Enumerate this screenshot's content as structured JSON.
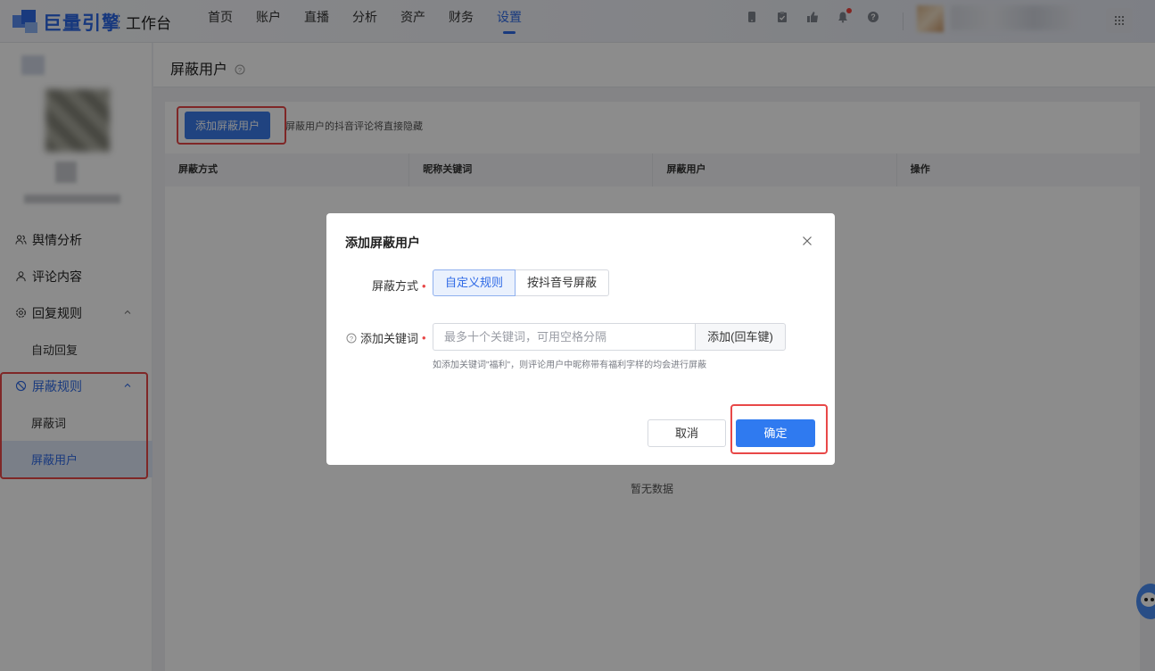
{
  "topbar": {
    "brand": "巨量引擎",
    "workbench": "工作台",
    "nav": [
      "首页",
      "账户",
      "直播",
      "分析",
      "资产",
      "财务",
      "设置"
    ],
    "active_nav": "设置",
    "icons": [
      "phone-icon",
      "clipboard-icon",
      "thumbs-up-icon",
      "bell-icon",
      "help-icon",
      "apps-grid-icon"
    ]
  },
  "sidebar": {
    "items": [
      {
        "label": "舆情分析",
        "icon": "people-icon"
      },
      {
        "label": "评论内容",
        "icon": "person-icon"
      },
      {
        "label": "回复规则",
        "icon": "gear-icon"
      },
      {
        "label": "自动回复"
      },
      {
        "label": "屏蔽规则",
        "icon": "ban-icon"
      },
      {
        "label": "屏蔽词"
      },
      {
        "label": "屏蔽用户"
      }
    ]
  },
  "page": {
    "title": "屏蔽用户",
    "add_button": "添加屏蔽用户",
    "hint": "屏蔽用户的抖音评论将直接隐藏",
    "columns": [
      "屏蔽方式",
      "昵称关键词",
      "屏蔽用户",
      "操作"
    ],
    "empty": "暂无数据"
  },
  "modal": {
    "title": "添加屏蔽用户",
    "mode_label": "屏蔽方式",
    "modes": [
      "自定义规则",
      "按抖音号屏蔽"
    ],
    "selected_mode": "自定义规则",
    "keyword_label": "添加关键词",
    "keyword_placeholder": "最多十个关键词，可用空格分隔",
    "keyword_value": "",
    "add_keyword_button": "添加(回车键)",
    "keyword_tip": "如添加关键词\"福利\"，则评论用户中昵称带有福利字样的均会进行屏蔽",
    "cancel": "取消",
    "confirm": "确定"
  },
  "colors": {
    "accent": "#2f6ae6",
    "highlight_box": "#e84848",
    "primary_button": "#2f7af0"
  }
}
